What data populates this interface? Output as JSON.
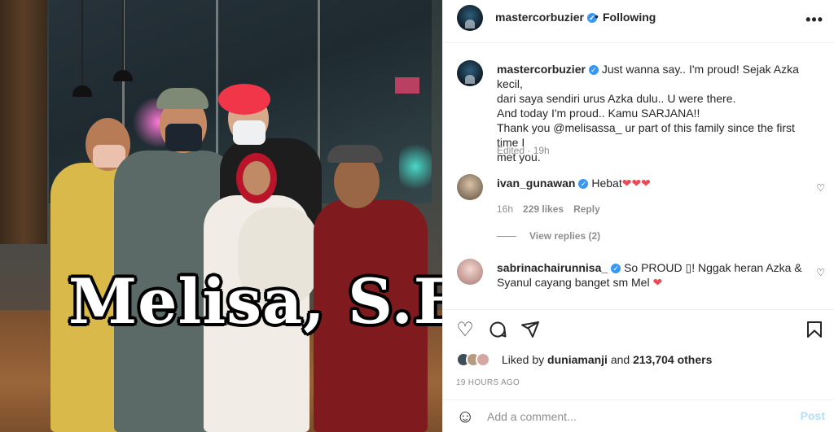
{
  "photo": {
    "overlay_caption": "Melisa, S.E."
  },
  "header": {
    "username": "mastercorbuzier",
    "verified_icon": "verified-badge-icon",
    "separator": "•",
    "follow_status": "Following",
    "more_icon": "more-options-icon"
  },
  "caption": {
    "username": "mastercorbuzier",
    "text_lines": [
      "Just wanna say.. I'm proud! Sejak Azka kecil,",
      "dari saya sendiri urus Azka dulu.. U were there.",
      "And today I'm proud.. Kamu SARJANA!!",
      "Thank you @melisassa_ ur part of this family since the first time I",
      "met you."
    ],
    "meta": "Edited · 19h"
  },
  "comments": [
    {
      "username": "ivan_gunawan",
      "text": "Hebat",
      "hearts": "❤❤❤",
      "time": "16h",
      "likes": "229 likes",
      "reply_label": "Reply",
      "view_replies": "View replies (2)"
    },
    {
      "username": "sabrinachairunnisa_",
      "text_line1": "So PROUD ▯! Nggak heran Azka &",
      "text_line2": "Syanul cayang banget sm Mel",
      "heart": "❤"
    }
  ],
  "actions": {
    "like_icon": "heart-icon",
    "comment_icon": "comment-icon",
    "share_icon": "share-icon",
    "save_icon": "bookmark-icon"
  },
  "likes": {
    "prefix": "Liked by",
    "first_user": "duniamanji",
    "and": "and",
    "others": "213,704 others"
  },
  "timestamp": "19 HOURS AGO",
  "add_comment": {
    "emoji_icon": "emoji-icon",
    "placeholder": "Add a comment...",
    "post_label": "Post"
  },
  "colors": {
    "verified": "#3897f0",
    "link_disabled": "#b2dffc",
    "heart_red": "#ed4956",
    "secondary_text": "#8e8e8e"
  }
}
